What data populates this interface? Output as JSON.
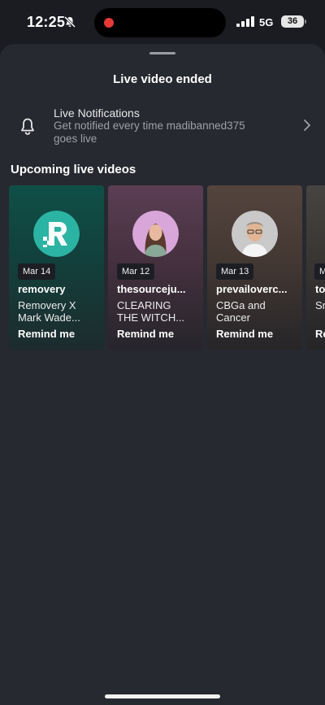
{
  "status_bar": {
    "time": "12:25",
    "network": "5G",
    "battery": "36"
  },
  "sheet": {
    "title": "Live video ended"
  },
  "notifications": {
    "title": "Live Notifications",
    "subtitle": "Get notified every time madibanned375 goes live"
  },
  "upcoming": {
    "heading": "Upcoming live videos",
    "cards": [
      {
        "date": "Mar 14",
        "user": "removery",
        "desc": "Removery X Mark Wade...",
        "cta": "Remind me"
      },
      {
        "date": "Mar 12",
        "user": "thesourceju...",
        "desc": "CLEARING THE WITCH...",
        "cta": "Remind me"
      },
      {
        "date": "Mar 13",
        "user": "prevailoverc...",
        "desc": "CBGa and Cancer",
        "cta": "Remind me"
      },
      {
        "date": "M",
        "user": "to",
        "desc": "Sn Fr",
        "cta": "Re"
      }
    ]
  },
  "colors": {
    "sheet_background": "#272930",
    "removery_brand": "#2bb3a3",
    "recording_dot": "#e53935"
  },
  "icons": [
    "silent-bell-icon",
    "cellular-signal-icon",
    "bell-icon",
    "chevron-right-icon",
    "removery-logo"
  ]
}
